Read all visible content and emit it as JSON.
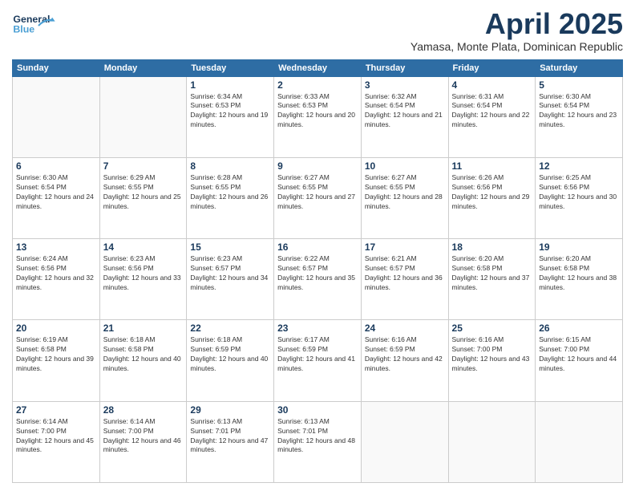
{
  "header": {
    "logo_line1": "General",
    "logo_line2": "Blue",
    "month": "April 2025",
    "location": "Yamasa, Monte Plata, Dominican Republic"
  },
  "days_of_week": [
    "Sunday",
    "Monday",
    "Tuesday",
    "Wednesday",
    "Thursday",
    "Friday",
    "Saturday"
  ],
  "weeks": [
    [
      {
        "num": "",
        "info": ""
      },
      {
        "num": "",
        "info": ""
      },
      {
        "num": "1",
        "info": "Sunrise: 6:34 AM\nSunset: 6:53 PM\nDaylight: 12 hours and 19 minutes."
      },
      {
        "num": "2",
        "info": "Sunrise: 6:33 AM\nSunset: 6:53 PM\nDaylight: 12 hours and 20 minutes."
      },
      {
        "num": "3",
        "info": "Sunrise: 6:32 AM\nSunset: 6:54 PM\nDaylight: 12 hours and 21 minutes."
      },
      {
        "num": "4",
        "info": "Sunrise: 6:31 AM\nSunset: 6:54 PM\nDaylight: 12 hours and 22 minutes."
      },
      {
        "num": "5",
        "info": "Sunrise: 6:30 AM\nSunset: 6:54 PM\nDaylight: 12 hours and 23 minutes."
      }
    ],
    [
      {
        "num": "6",
        "info": "Sunrise: 6:30 AM\nSunset: 6:54 PM\nDaylight: 12 hours and 24 minutes."
      },
      {
        "num": "7",
        "info": "Sunrise: 6:29 AM\nSunset: 6:55 PM\nDaylight: 12 hours and 25 minutes."
      },
      {
        "num": "8",
        "info": "Sunrise: 6:28 AM\nSunset: 6:55 PM\nDaylight: 12 hours and 26 minutes."
      },
      {
        "num": "9",
        "info": "Sunrise: 6:27 AM\nSunset: 6:55 PM\nDaylight: 12 hours and 27 minutes."
      },
      {
        "num": "10",
        "info": "Sunrise: 6:27 AM\nSunset: 6:55 PM\nDaylight: 12 hours and 28 minutes."
      },
      {
        "num": "11",
        "info": "Sunrise: 6:26 AM\nSunset: 6:56 PM\nDaylight: 12 hours and 29 minutes."
      },
      {
        "num": "12",
        "info": "Sunrise: 6:25 AM\nSunset: 6:56 PM\nDaylight: 12 hours and 30 minutes."
      }
    ],
    [
      {
        "num": "13",
        "info": "Sunrise: 6:24 AM\nSunset: 6:56 PM\nDaylight: 12 hours and 32 minutes."
      },
      {
        "num": "14",
        "info": "Sunrise: 6:23 AM\nSunset: 6:56 PM\nDaylight: 12 hours and 33 minutes."
      },
      {
        "num": "15",
        "info": "Sunrise: 6:23 AM\nSunset: 6:57 PM\nDaylight: 12 hours and 34 minutes."
      },
      {
        "num": "16",
        "info": "Sunrise: 6:22 AM\nSunset: 6:57 PM\nDaylight: 12 hours and 35 minutes."
      },
      {
        "num": "17",
        "info": "Sunrise: 6:21 AM\nSunset: 6:57 PM\nDaylight: 12 hours and 36 minutes."
      },
      {
        "num": "18",
        "info": "Sunrise: 6:20 AM\nSunset: 6:58 PM\nDaylight: 12 hours and 37 minutes."
      },
      {
        "num": "19",
        "info": "Sunrise: 6:20 AM\nSunset: 6:58 PM\nDaylight: 12 hours and 38 minutes."
      }
    ],
    [
      {
        "num": "20",
        "info": "Sunrise: 6:19 AM\nSunset: 6:58 PM\nDaylight: 12 hours and 39 minutes."
      },
      {
        "num": "21",
        "info": "Sunrise: 6:18 AM\nSunset: 6:58 PM\nDaylight: 12 hours and 40 minutes."
      },
      {
        "num": "22",
        "info": "Sunrise: 6:18 AM\nSunset: 6:59 PM\nDaylight: 12 hours and 40 minutes."
      },
      {
        "num": "23",
        "info": "Sunrise: 6:17 AM\nSunset: 6:59 PM\nDaylight: 12 hours and 41 minutes."
      },
      {
        "num": "24",
        "info": "Sunrise: 6:16 AM\nSunset: 6:59 PM\nDaylight: 12 hours and 42 minutes."
      },
      {
        "num": "25",
        "info": "Sunrise: 6:16 AM\nSunset: 7:00 PM\nDaylight: 12 hours and 43 minutes."
      },
      {
        "num": "26",
        "info": "Sunrise: 6:15 AM\nSunset: 7:00 PM\nDaylight: 12 hours and 44 minutes."
      }
    ],
    [
      {
        "num": "27",
        "info": "Sunrise: 6:14 AM\nSunset: 7:00 PM\nDaylight: 12 hours and 45 minutes."
      },
      {
        "num": "28",
        "info": "Sunrise: 6:14 AM\nSunset: 7:00 PM\nDaylight: 12 hours and 46 minutes."
      },
      {
        "num": "29",
        "info": "Sunrise: 6:13 AM\nSunset: 7:01 PM\nDaylight: 12 hours and 47 minutes."
      },
      {
        "num": "30",
        "info": "Sunrise: 6:13 AM\nSunset: 7:01 PM\nDaylight: 12 hours and 48 minutes."
      },
      {
        "num": "",
        "info": ""
      },
      {
        "num": "",
        "info": ""
      },
      {
        "num": "",
        "info": ""
      }
    ]
  ]
}
